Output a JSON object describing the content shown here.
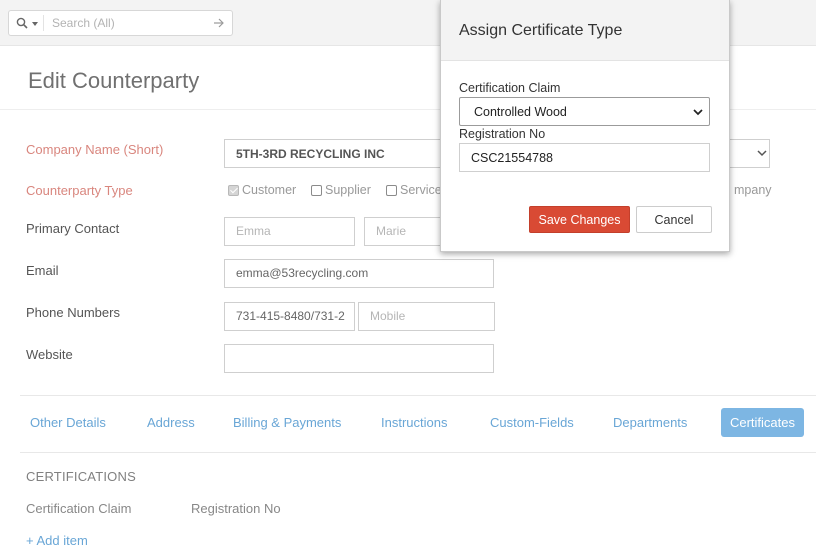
{
  "search": {
    "placeholder": "Search (All)"
  },
  "page": {
    "title": "Edit Counterparty"
  },
  "form": {
    "company_name_label": "Company Name (Short)",
    "company_name_value": "5TH-3RD RECYCLING INC",
    "counterparty_type_label": "Counterparty Type",
    "types": [
      {
        "label": "Customer",
        "checked": true
      },
      {
        "label": "Supplier",
        "checked": false
      },
      {
        "label": "Service",
        "checked": false
      }
    ],
    "type_trailing_text": "mpany",
    "primary_contact_label": "Primary Contact",
    "first_name": "Emma",
    "last_name": "Marie",
    "email_label": "Email",
    "email_value": "emma@53recycling.com",
    "phone_label": "Phone Numbers",
    "phone_value": "731-415-8480/731-2",
    "mobile_placeholder": "Mobile",
    "website_label": "Website",
    "website_value": ""
  },
  "tabs": [
    {
      "label": "Other Details"
    },
    {
      "label": "Address"
    },
    {
      "label": "Billing & Payments"
    },
    {
      "label": "Instructions"
    },
    {
      "label": "Custom-Fields"
    },
    {
      "label": "Departments"
    },
    {
      "label": "Certificates",
      "active": true
    }
  ],
  "certifications": {
    "heading": "CERTIFICATIONS",
    "col_claim": "Certification Claim",
    "col_reg": "Registration No",
    "add_item": "+ Add item"
  },
  "modal": {
    "title": "Assign Certificate Type",
    "claim_label": "Certification Claim",
    "claim_value": "Controlled Wood",
    "reg_label": "Registration No",
    "reg_value": "CSC21554788",
    "save_label": "Save Changes",
    "cancel_label": "Cancel"
  },
  "colors": {
    "required_label": "#d9867e",
    "tab_link": "#69a6d6",
    "tab_active_bg": "#7db6e3",
    "save_button": "#d94a34"
  }
}
